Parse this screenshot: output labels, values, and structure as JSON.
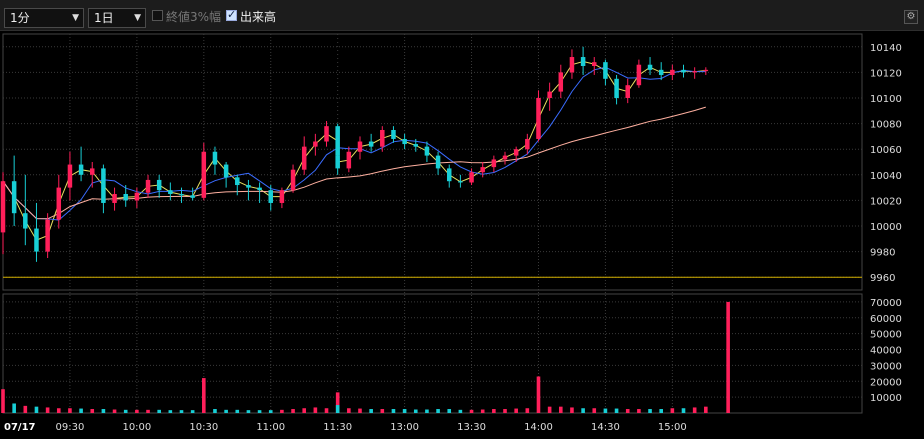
{
  "toolbar": {
    "interval": "1分",
    "range": "1日",
    "option_close3": "終値3%幅",
    "option_close3_checked": false,
    "option_volume": "出来高",
    "option_volume_checked": true
  },
  "colors": {
    "background": "#000000",
    "grid": "#3a3a3a",
    "up": "#ff1f5a",
    "down": "#18cfd6",
    "ma_short": "#e8e060",
    "ma_mid": "#3a6cff",
    "ma_long": "#ffb0a0",
    "base_line": "#d4b000"
  },
  "chart_data": [
    {
      "type": "candlestick",
      "date_label": "07/17",
      "x_tick_labels": [
        "09:30",
        "10:00",
        "10:30",
        "11:00",
        "11:30",
        "13:00",
        "13:30",
        "14:00",
        "14:30",
        "15:00"
      ],
      "y_tick_labels": [
        "9960",
        "9980",
        "10000",
        "10020",
        "10040",
        "10060",
        "10080",
        "10100",
        "10120",
        "10140"
      ],
      "ylim": [
        9950,
        10150
      ],
      "reference_line": 9960,
      "grid": true,
      "candles": [
        [
          "09:00",
          9995,
          10042,
          9978,
          10035
        ],
        [
          "09:05",
          10035,
          10055,
          10000,
          10010
        ],
        [
          "09:10",
          10010,
          10040,
          9985,
          9998
        ],
        [
          "09:15",
          9998,
          10018,
          9972,
          9980
        ],
        [
          "09:20",
          9980,
          10010,
          9975,
          10005
        ],
        [
          "09:25",
          10005,
          10040,
          9998,
          10030
        ],
        [
          "09:30",
          10030,
          10058,
          10020,
          10048
        ],
        [
          "09:35",
          10048,
          10062,
          10035,
          10040
        ],
        [
          "09:40",
          10040,
          10050,
          10030,
          10045
        ],
        [
          "09:45",
          10045,
          10048,
          10010,
          10018
        ],
        [
          "09:50",
          10018,
          10030,
          10012,
          10025
        ],
        [
          "09:55",
          10025,
          10032,
          10015,
          10020
        ],
        [
          "10:00",
          10020,
          10030,
          10014,
          10026
        ],
        [
          "10:05",
          10026,
          10040,
          10022,
          10036
        ],
        [
          "10:10",
          10036,
          10040,
          10022,
          10028
        ],
        [
          "10:15",
          10028,
          10034,
          10020,
          10025
        ],
        [
          "10:20",
          10025,
          10030,
          10018,
          10024
        ],
        [
          "10:25",
          10024,
          10030,
          10020,
          10022
        ],
        [
          "10:30",
          10022,
          10065,
          10020,
          10058
        ],
        [
          "10:35",
          10058,
          10062,
          10040,
          10048
        ],
        [
          "10:40",
          10048,
          10050,
          10030,
          10038
        ],
        [
          "10:45",
          10038,
          10040,
          10024,
          10032
        ],
        [
          "10:50",
          10032,
          10036,
          10020,
          10030
        ],
        [
          "10:55",
          10030,
          10034,
          10018,
          10028
        ],
        [
          "11:00",
          10028,
          10032,
          10012,
          10018
        ],
        [
          "11:05",
          10018,
          10030,
          10014,
          10028
        ],
        [
          "11:10",
          10028,
          10048,
          10026,
          10044
        ],
        [
          "11:15",
          10044,
          10070,
          10040,
          10062
        ],
        [
          "11:20",
          10062,
          10072,
          10055,
          10066
        ],
        [
          "11:25",
          10066,
          10082,
          10062,
          10078
        ],
        [
          "11:30",
          10078,
          10080,
          10050,
          10055
        ],
        [
          "12:30",
          10055,
          10060,
          10040,
          10045
        ],
        [
          "12:35",
          10045,
          10062,
          10042,
          10058
        ],
        [
          "12:40",
          10058,
          10070,
          10052,
          10066
        ],
        [
          "12:45",
          10066,
          10072,
          10058,
          10062
        ],
        [
          "12:50",
          10062,
          10078,
          10058,
          10075
        ],
        [
          "12:55",
          10075,
          10078,
          10065,
          10068
        ],
        [
          "13:00",
          10068,
          10072,
          10060,
          10064
        ],
        [
          "13:05",
          10064,
          10068,
          10058,
          10062
        ],
        [
          "13:10",
          10062,
          10066,
          10050,
          10055
        ],
        [
          "13:15",
          10055,
          10058,
          10040,
          10045
        ],
        [
          "13:20",
          10045,
          10048,
          10030,
          10035
        ],
        [
          "13:25",
          10035,
          10040,
          10030,
          10034
        ],
        [
          "13:30",
          10034,
          10045,
          10032,
          10042
        ],
        [
          "13:35",
          10042,
          10050,
          10038,
          10046
        ],
        [
          "13:40",
          10046,
          10055,
          10042,
          10052
        ],
        [
          "13:45",
          10052,
          10058,
          10048,
          10055
        ],
        [
          "13:50",
          10055,
          10062,
          10050,
          10060
        ],
        [
          "13:55",
          10060,
          10072,
          10056,
          10068
        ],
        [
          "14:00",
          10068,
          10106,
          10066,
          10100
        ],
        [
          "14:05",
          10100,
          10112,
          10090,
          10105
        ],
        [
          "14:10",
          10105,
          10126,
          10100,
          10120
        ],
        [
          "14:15",
          10120,
          10138,
          10115,
          10132
        ],
        [
          "14:20",
          10132,
          10140,
          10118,
          10125
        ],
        [
          "14:25",
          10125,
          10132,
          10118,
          10128
        ],
        [
          "14:30",
          10128,
          10130,
          10110,
          10115
        ],
        [
          "14:35",
          10115,
          10118,
          10095,
          10100
        ],
        [
          "14:40",
          10100,
          10115,
          10096,
          10110
        ],
        [
          "14:45",
          10110,
          10130,
          10108,
          10126
        ],
        [
          "14:50",
          10126,
          10132,
          10118,
          10122
        ],
        [
          "14:55",
          10122,
          10128,
          10114,
          10118
        ],
        [
          "15:00",
          10118,
          10126,
          10114,
          10122
        ],
        [
          "15:05",
          10122,
          10126,
          10116,
          10120
        ],
        [
          "15:10",
          10120,
          10124,
          10115,
          10121
        ],
        [
          "15:15",
          10121,
          10124,
          10118,
          10122
        ]
      ]
    },
    {
      "type": "bar",
      "title": "出来高",
      "y_tick_labels": [
        "10000",
        "20000",
        "30000",
        "40000",
        "50000",
        "60000",
        "70000"
      ],
      "ylim": [
        0,
        75000
      ],
      "x": [
        "09:00",
        "09:05",
        "09:10",
        "09:15",
        "09:20",
        "09:25",
        "09:30",
        "09:35",
        "09:40",
        "09:45",
        "09:50",
        "09:55",
        "10:00",
        "10:05",
        "10:10",
        "10:15",
        "10:20",
        "10:25",
        "10:30",
        "10:35",
        "10:40",
        "10:45",
        "10:50",
        "10:55",
        "11:00",
        "11:05",
        "11:10",
        "11:15",
        "11:20",
        "11:25",
        "11:30",
        "12:30",
        "12:35",
        "12:40",
        "12:45",
        "12:50",
        "12:55",
        "13:00",
        "13:05",
        "13:10",
        "13:15",
        "13:20",
        "13:25",
        "13:30",
        "13:35",
        "13:40",
        "13:45",
        "13:50",
        "13:55",
        "14:00",
        "14:05",
        "14:10",
        "14:15",
        "14:20",
        "14:25",
        "14:30",
        "14:35",
        "14:40",
        "14:45",
        "14:50",
        "14:55",
        "15:00",
        "15:05",
        "15:10",
        "15:15",
        "15:25"
      ],
      "values": [
        15000,
        6000,
        4500,
        4000,
        3500,
        3000,
        3000,
        2800,
        2500,
        2500,
        2200,
        2000,
        2000,
        2000,
        2000,
        1800,
        1800,
        1800,
        22000,
        2500,
        2000,
        2000,
        1800,
        1800,
        1800,
        2000,
        2500,
        3000,
        3500,
        3000,
        13000,
        5000,
        3000,
        2800,
        2500,
        2500,
        2500,
        2500,
        2200,
        2200,
        2500,
        2500,
        2000,
        2000,
        2200,
        2500,
        2500,
        2800,
        3000,
        23000,
        4000,
        4000,
        3500,
        3000,
        3000,
        2800,
        2800,
        2500,
        2500,
        2500,
        2500,
        3000,
        3000,
        3500,
        4000,
        70000
      ],
      "up": [
        1,
        0,
        1,
        0,
        1,
        1,
        1,
        0,
        1,
        0,
        1,
        0,
        1,
        1,
        0,
        0,
        0,
        0,
        1,
        0,
        0,
        0,
        0,
        0,
        0,
        1,
        1,
        1,
        1,
        1,
        1,
        0,
        1,
        1,
        0,
        1,
        0,
        0,
        0,
        0,
        0,
        0,
        0,
        1,
        1,
        1,
        1,
        1,
        1,
        1,
        1,
        1,
        1,
        0,
        1,
        0,
        0,
        1,
        1,
        0,
        0,
        1,
        0,
        1,
        1,
        1
      ]
    }
  ]
}
